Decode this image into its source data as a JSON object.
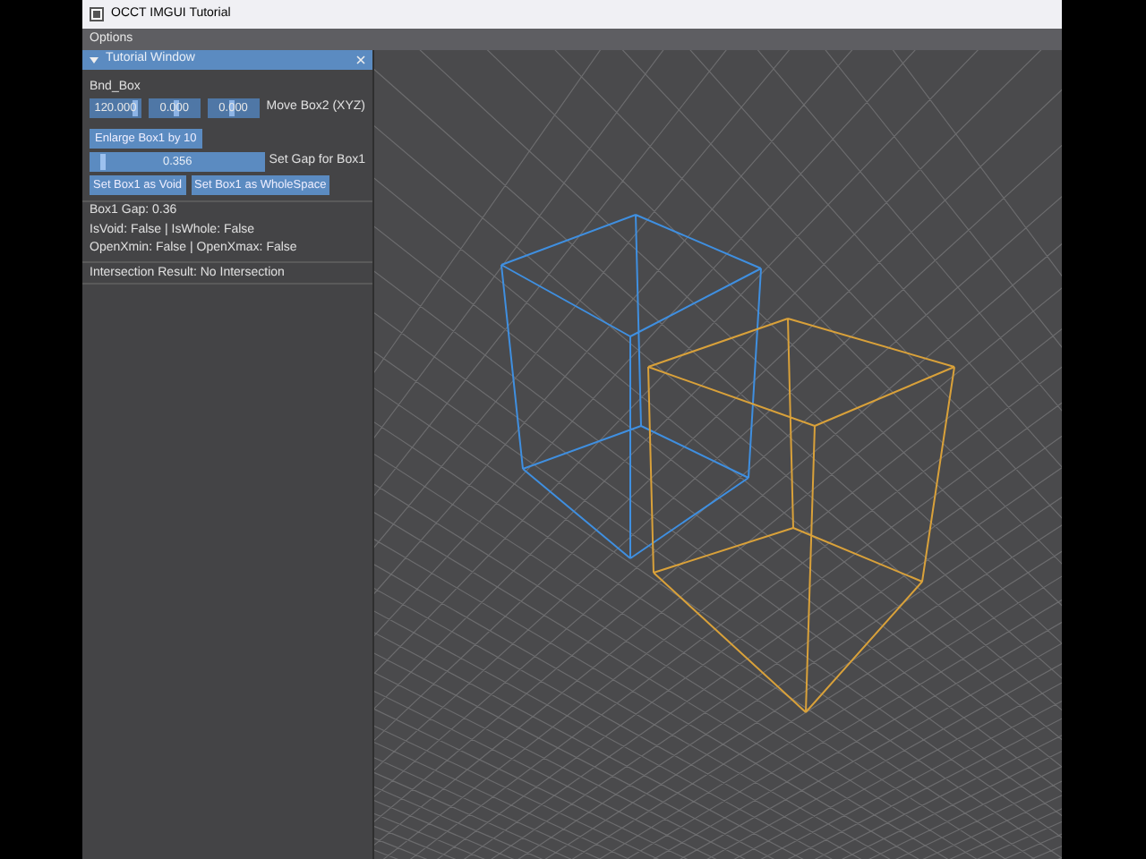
{
  "window": {
    "title": "OCCT IMGUI Tutorial"
  },
  "menu": [
    "Options"
  ],
  "panel": {
    "title": "Tutorial Window",
    "expanded": true,
    "section": "Bnd_Box",
    "move_fields": [
      {
        "value": "120.000",
        "level": 0.85
      },
      {
        "value": "0.000",
        "level": 0.5
      },
      {
        "value": "0.000",
        "level": 0.45
      }
    ],
    "move_label": "Move Box2 (XYZ)",
    "enlarge_button": "Enlarge Box1 by 10",
    "gap_slider": {
      "value": "0.356",
      "level": 0.05,
      "label": "Set Gap for Box1"
    },
    "buttons": [
      "Set Box1 as Void",
      "Set Box1 as WholeSpace"
    ],
    "info": [
      "Box1 Gap: 0.36",
      "IsVoid: False | IsWhole: False",
      "OpenXmin: False | OpenXmax: False"
    ],
    "result": "Intersection Result: No Intersection"
  }
}
